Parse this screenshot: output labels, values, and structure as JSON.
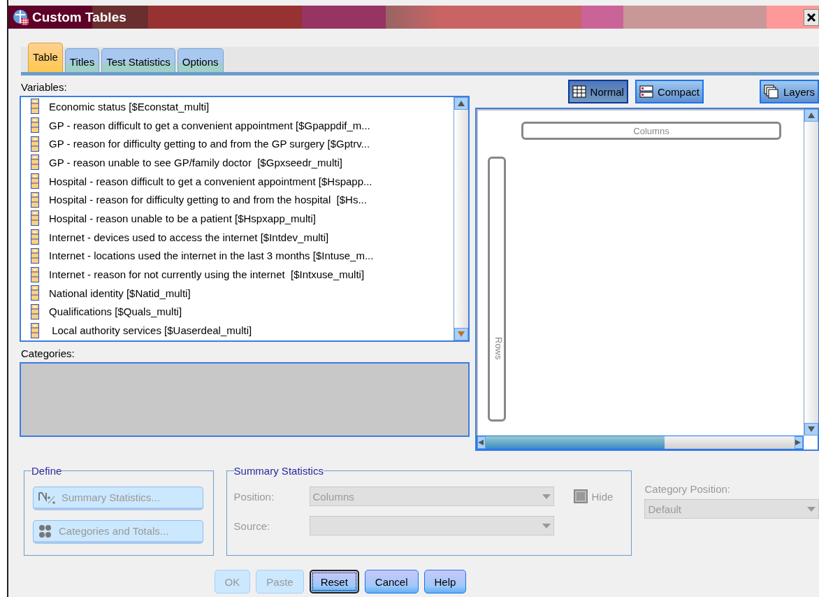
{
  "window": {
    "title": "Custom Tables"
  },
  "tabs": [
    {
      "label": "Table",
      "selected": true
    },
    {
      "label": "Titles",
      "selected": false
    },
    {
      "label": "Test Statistics",
      "selected": false
    },
    {
      "label": "Options",
      "selected": false
    }
  ],
  "variables": {
    "label": "Variables:",
    "items": [
      {
        "text": "Economic status [$Econstat_multi]"
      },
      {
        "text": "GP - reason difficult to get a convenient appointment [$Gpappdif_m..."
      },
      {
        "text": "GP - reason for difficulty getting to and from the GP surgery [$Gptrv..."
      },
      {
        "text": "GP - reason unable to see GP/family doctor  [$Gpxseedr_multi]"
      },
      {
        "text": "Hospital - reason difficult to get a convenient appointment [$Hspapp..."
      },
      {
        "text": "Hospital - reason for difficulty getting to and from the hospital  [$Hs..."
      },
      {
        "text": "Hospital - reason unable to be a patient [$Hspxapp_multi]"
      },
      {
        "text": "Internet - devices used to access the internet [$Intdev_multi]"
      },
      {
        "text": "Internet - locations used the internet in the last 3 months [$Intuse_m..."
      },
      {
        "text": "Internet - reason for not currently using the internet  [$Intxuse_multi]"
      },
      {
        "text": "National identity [$Natid_multi]"
      },
      {
        "text": "Qualifications [$Quals_multi]"
      },
      {
        "text": " Local authority services [$Uaserdeal_multi]"
      }
    ]
  },
  "view_buttons": [
    {
      "label": "Normal",
      "kind": "grid",
      "selected": true
    },
    {
      "label": "Compact",
      "kind": "compact",
      "selected": false
    },
    {
      "label": "Layers",
      "kind": "layers",
      "selected": false
    }
  ],
  "canvas": {
    "columns_label": "Columns",
    "rows_label": "Rows"
  },
  "categories": {
    "label": "Categories:"
  },
  "define": {
    "title": "Define",
    "buttons": [
      {
        "label": "Summary Statistics...",
        "kind": "stats",
        "disabled": true
      },
      {
        "label": "Categories and Totals...",
        "kind": "categories",
        "disabled": true
      }
    ]
  },
  "summary_statistics": {
    "title": "Summary Statistics",
    "position_label": "Position:",
    "position_value": "Columns",
    "source_label": "Source:",
    "hide": {
      "label": "Hide",
      "checked": false
    }
  },
  "category_position": {
    "label": "Category Position:",
    "value": "Default"
  },
  "buttons": [
    {
      "label": "OK",
      "disabled": true,
      "focused": false
    },
    {
      "label": "Paste",
      "disabled": true,
      "focused": false
    },
    {
      "label": "Reset",
      "disabled": false,
      "focused": true
    },
    {
      "label": "Cancel",
      "disabled": false,
      "focused": false
    },
    {
      "label": "Help",
      "disabled": false,
      "focused": false
    }
  ]
}
